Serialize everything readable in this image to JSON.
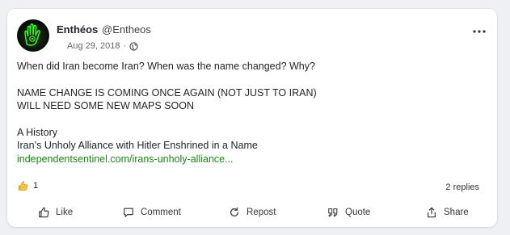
{
  "post": {
    "author_name": "Enthéos",
    "author_handle": "@Entheos",
    "date": "Aug 29, 2018",
    "meta_separator": "·",
    "visibility_icon": "globe-icon",
    "more_icon": "ellipsis-icon",
    "lines": [
      "When did Iran become Iran?  When was the name changed?  Why?",
      "NAME CHANGE IS COMING ONCE AGAIN (NOT JUST TO IRAN)",
      "WILL NEED SOME NEW MAPS SOON",
      "A History",
      "Iran’s Unholy Alliance with Hitler Enshrined in a Name"
    ],
    "link_text": "independentsentinel.com/irans-unholy-alliance...",
    "link_color": "#1a8917"
  },
  "reactions": {
    "icon": "thumbs-up-emoji",
    "count": "1",
    "replies_label": "2 replies"
  },
  "actions": {
    "like": "Like",
    "comment": "Comment",
    "repost": "Repost",
    "quote": "Quote",
    "share": "Share"
  },
  "colors": {
    "background": "#eef0f3",
    "card": "#ffffff",
    "avatar_glow": "#39ff14"
  }
}
